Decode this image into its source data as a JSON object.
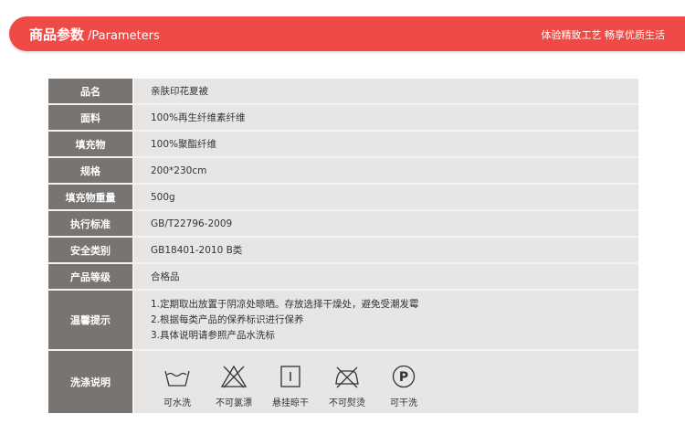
{
  "header": {
    "title_cn": "商品参数",
    "title_en": "/Parameters",
    "slogan": "体验精致工艺 畅享优质生活"
  },
  "params": [
    {
      "label": "品名",
      "value": "亲肤印花夏被"
    },
    {
      "label": "面料",
      "value": "100%再生纤维素纤维"
    },
    {
      "label": "填充物",
      "value": "100%聚酯纤维"
    },
    {
      "label": "规格",
      "value": "200*230cm"
    },
    {
      "label": "填充物重量",
      "value": "500g"
    },
    {
      "label": "执行标准",
      "value": "GB/T22796-2009"
    },
    {
      "label": "安全类别",
      "value": "GB18401-2010 B类"
    },
    {
      "label": "产品等级",
      "value": "合格品"
    }
  ],
  "tips": {
    "label": "温馨提示",
    "lines": [
      "1.定期取出放置于阴凉处晾晒。存放选择干燥处，避免受潮发霉",
      "2.根据每类产品的保养标识进行保养",
      "3.具体说明请参照产品水洗标"
    ]
  },
  "washing": {
    "label": "洗涤说明",
    "items": [
      {
        "icon": "washtub-icon",
        "caption": "可水洗"
      },
      {
        "icon": "no-bleach-icon",
        "caption": "不可氯漂"
      },
      {
        "icon": "hang-dry-icon",
        "caption": "悬挂晾干"
      },
      {
        "icon": "no-iron-icon",
        "caption": "不可熨烫"
      },
      {
        "icon": "dry-clean-p-icon",
        "caption": "可干洗"
      }
    ]
  },
  "colors": {
    "banner": "#f04a46",
    "label_bg": "#777472",
    "value_bg": "#e7e6e5"
  }
}
